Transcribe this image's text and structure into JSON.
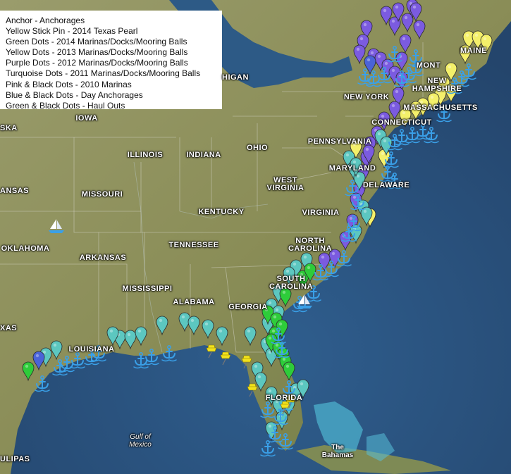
{
  "legend": {
    "items": [
      "Anchor - Anchorages",
      "Yellow Stick Pin - 2014 Texas Pearl",
      "Green Dots - 2014 Marinas/Docks/Mooring Balls",
      "Yellow Dots - 2013 Marinas/Docks/Mooring Balls",
      "Purple Dots - 2012 Marinas/Docks/Mooring Balls",
      "Turquoise Dots - 2011 Marinas/Docks/Mooring Balls",
      "Pink & Black Dots - 2010 Marinas",
      "Blue & Black Dots - Day Anchorages",
      "Green & Black Dots - Haul Outs"
    ]
  },
  "labels": {
    "michigan": "HIGAN",
    "iowa": "IOWA",
    "ska": "SKA",
    "illinois": "ILLINOIS",
    "indiana": "INDIANA",
    "ohio": "OHIO",
    "pennsylvania": "PENNSYLVANIA",
    "new_york": "NEW YORK",
    "vermont": "MONT",
    "new_hampshire": "NEW\nHAMPSHIRE",
    "massachusetts": "MASSACHUSETTS",
    "connecticut": "CONNECTICUT",
    "maryland": "MARYLAND",
    "delaware": "DELAWARE",
    "west_virginia": "WEST\nVIRGINIA",
    "virginia": "VIRGINIA",
    "kansas": "ANSAS",
    "missouri": "MISSOURI",
    "kentucky": "KENTUCKY",
    "tennessee": "TENNESSEE",
    "north_carolina": "NORTH\nCAROLINA",
    "oklahoma": "OKLAHOMA",
    "arkansas": "ARKANSAS",
    "south_carolina": "SOUTH\nCAROLINA",
    "mississippi": "MISSISSIPPI",
    "alabama": "ALABAMA",
    "georgia": "GEORGIA",
    "louisiana": "LOUISIANA",
    "florida": "FLORIDA",
    "texas": "XAS",
    "maine": "MAINE",
    "gulf_of_mexico": "Gulf of\nMexico",
    "bahamas": "The\nBahamas",
    "tamaulipas": "ULIPAS"
  },
  "colors": {
    "ocean": "#2a4f7a",
    "land": "#8d8f5a",
    "turquoise_pin": "#5cc7c0",
    "purple_pin": "#7b5be0",
    "yellow_pin": "#f4f06a",
    "green_pin": "#2ecc3a",
    "anchor": "#3aa0e8",
    "stickpin": "#f2e21c"
  },
  "markers": {
    "anchor_icon": "anchor-icon",
    "pin_icon": "map-pin-icon",
    "stickpin_icon": "stick-pin-icon",
    "sailboat_icon": "sailboat-icon"
  }
}
